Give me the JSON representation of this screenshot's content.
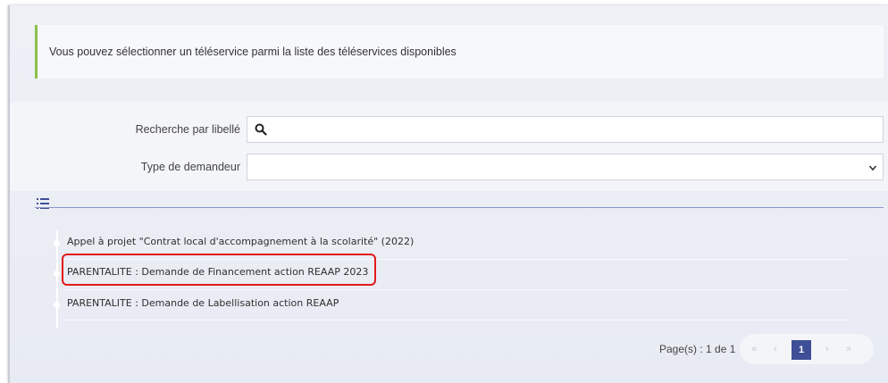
{
  "info": {
    "message": "Vous pouvez sélectionner un téléservice parmi la liste des téléservices disponibles"
  },
  "filters": {
    "search_label": "Recherche par libellé",
    "search_value": "",
    "type_label": "Type de demandeur",
    "type_value": ""
  },
  "list": {
    "items": [
      {
        "label": "Appel à projet \"Contrat local d'accompagnement à la scolarité\" (2022)"
      },
      {
        "label": "PARENTALITE : Demande de Financement action REAAP 2023",
        "highlighted": true
      },
      {
        "label": "PARENTALITE : Demande de Labellisation action REAAP"
      }
    ]
  },
  "pagination": {
    "info": "Page(s) : 1 de 1",
    "first": "«",
    "prev": "‹",
    "current": "1",
    "next": "›",
    "last": "»"
  },
  "colors": {
    "accent": "#3e4f97",
    "info_border": "#8cc04b",
    "highlight": "#e21a1a"
  }
}
